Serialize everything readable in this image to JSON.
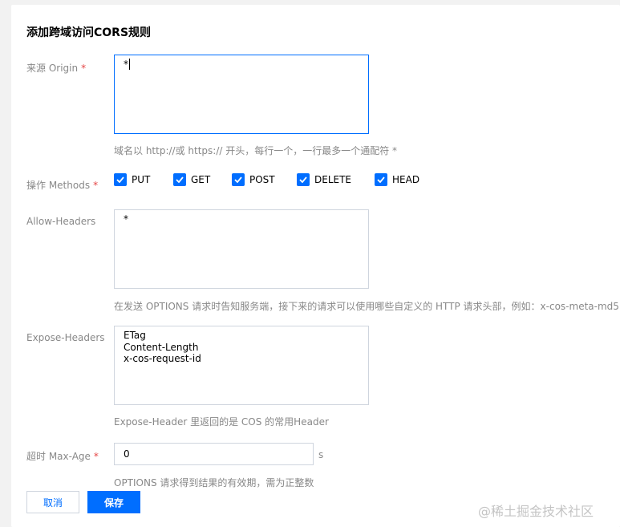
{
  "dialog": {
    "title": "添加跨域访问CORS规则"
  },
  "origin": {
    "label": "来源 Origin",
    "required_mark": "*",
    "value": "*",
    "hint": "域名以 http://或 https:// 开头，每行一个，一行最多一个通配符 *"
  },
  "methods": {
    "label": "操作 Methods",
    "required_mark": "*",
    "items": [
      {
        "label": "PUT",
        "checked": true
      },
      {
        "label": "GET",
        "checked": true
      },
      {
        "label": "POST",
        "checked": true
      },
      {
        "label": "DELETE",
        "checked": true
      },
      {
        "label": "HEAD",
        "checked": true
      }
    ]
  },
  "allow_headers": {
    "label": "Allow-Headers",
    "value": "*",
    "hint": "在发送 OPTIONS 请求时告知服务端，接下来的请求可以使用哪些自定义的 HTTP 请求头部，例如：x-cos-meta-md5"
  },
  "expose_headers": {
    "label": "Expose-Headers",
    "value": "ETag\nContent-Length\nx-cos-request-id",
    "hint": "Expose-Header 里返回的是 COS 的常用Header"
  },
  "max_age": {
    "label": "超时 Max-Age",
    "required_mark": "*",
    "value": "0",
    "unit": "s",
    "hint": "OPTIONS 请求得到结果的有效期，需为正整数"
  },
  "buttons": {
    "cancel": "取消",
    "save": "保存"
  },
  "watermark": "@稀土掘金技术社区",
  "colors": {
    "accent": "#006eff",
    "required": "#e54545"
  }
}
